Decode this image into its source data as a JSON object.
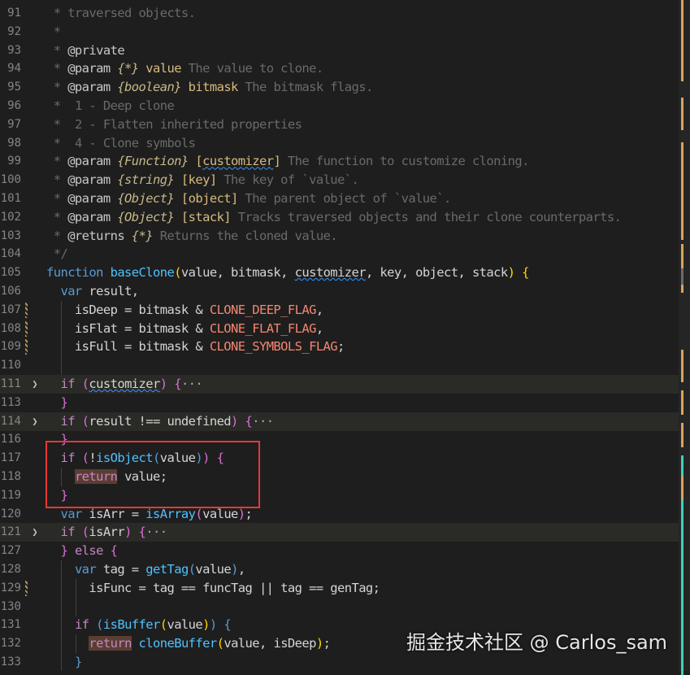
{
  "editor": {
    "lines": [
      {
        "n": "91",
        "fold": false,
        "mod": false,
        "hl": false,
        "t": [
          {
            "c": "cs",
            "s": " * "
          },
          {
            "c": "c",
            "s": "traversed objects."
          }
        ]
      },
      {
        "n": "92",
        "fold": false,
        "mod": false,
        "hl": false,
        "t": [
          {
            "c": "cs",
            "s": " *"
          }
        ]
      },
      {
        "n": "93",
        "fold": false,
        "mod": false,
        "hl": false,
        "t": [
          {
            "c": "cs",
            "s": " * "
          },
          {
            "c": "cl",
            "s": "@private"
          }
        ]
      },
      {
        "n": "94",
        "fold": false,
        "mod": false,
        "hl": false,
        "t": [
          {
            "c": "cs",
            "s": " * "
          },
          {
            "c": "cl",
            "s": "@param "
          },
          {
            "c": "ct",
            "s": "{*}"
          },
          {
            "c": "cp",
            "s": " value"
          },
          {
            "c": "c",
            "s": " The value to clone."
          }
        ]
      },
      {
        "n": "95",
        "fold": false,
        "mod": false,
        "hl": false,
        "t": [
          {
            "c": "cs",
            "s": " * "
          },
          {
            "c": "cl",
            "s": "@param "
          },
          {
            "c": "ct",
            "s": "{boolean}"
          },
          {
            "c": "cp",
            "s": " bitmask"
          },
          {
            "c": "c",
            "s": " The bitmask flags."
          }
        ]
      },
      {
        "n": "96",
        "fold": false,
        "mod": false,
        "hl": false,
        "t": [
          {
            "c": "cs",
            "s": " *  "
          },
          {
            "c": "c",
            "s": "1 - Deep clone"
          }
        ]
      },
      {
        "n": "97",
        "fold": false,
        "mod": false,
        "hl": false,
        "t": [
          {
            "c": "cs",
            "s": " *  "
          },
          {
            "c": "c",
            "s": "2 - Flatten inherited properties"
          }
        ]
      },
      {
        "n": "98",
        "fold": false,
        "mod": false,
        "hl": false,
        "t": [
          {
            "c": "cs",
            "s": " *  "
          },
          {
            "c": "c",
            "s": "4 - Clone symbols"
          }
        ]
      },
      {
        "n": "99",
        "fold": false,
        "mod": false,
        "hl": false,
        "t": [
          {
            "c": "cs",
            "s": " * "
          },
          {
            "c": "cl",
            "s": "@param "
          },
          {
            "c": "ct",
            "s": "{Function}"
          },
          {
            "c": "cp",
            "s": " ["
          },
          {
            "c": "cp sq",
            "s": "customizer"
          },
          {
            "c": "cp",
            "s": "]"
          },
          {
            "c": "c",
            "s": " The function to customize cloning."
          }
        ]
      },
      {
        "n": "100",
        "fold": false,
        "mod": false,
        "hl": false,
        "t": [
          {
            "c": "cs",
            "s": " * "
          },
          {
            "c": "cl",
            "s": "@param "
          },
          {
            "c": "ct",
            "s": "{string}"
          },
          {
            "c": "cp",
            "s": " [key]"
          },
          {
            "c": "c",
            "s": " The key of `value`."
          }
        ]
      },
      {
        "n": "101",
        "fold": false,
        "mod": false,
        "hl": false,
        "t": [
          {
            "c": "cs",
            "s": " * "
          },
          {
            "c": "cl",
            "s": "@param "
          },
          {
            "c": "ct",
            "s": "{Object}"
          },
          {
            "c": "cp",
            "s": " [object]"
          },
          {
            "c": "c",
            "s": " The parent object of `value`."
          }
        ]
      },
      {
        "n": "102",
        "fold": false,
        "mod": false,
        "hl": false,
        "t": [
          {
            "c": "cs",
            "s": " * "
          },
          {
            "c": "cl",
            "s": "@param "
          },
          {
            "c": "ct",
            "s": "{Object}"
          },
          {
            "c": "cp",
            "s": " [stack]"
          },
          {
            "c": "c",
            "s": " Tracks traversed objects and their clone counterparts."
          }
        ]
      },
      {
        "n": "103",
        "fold": false,
        "mod": false,
        "hl": false,
        "t": [
          {
            "c": "cs",
            "s": " * "
          },
          {
            "c": "cl",
            "s": "@returns "
          },
          {
            "c": "ct",
            "s": "{*}"
          },
          {
            "c": "c",
            "s": " Returns the cloned value."
          }
        ]
      },
      {
        "n": "104",
        "fold": false,
        "mod": false,
        "hl": false,
        "t": [
          {
            "c": "cs",
            "s": " */"
          }
        ]
      },
      {
        "n": "105",
        "fold": false,
        "mod": false,
        "hl": false,
        "t": [
          {
            "c": "kb",
            "s": "function "
          },
          {
            "c": "f",
            "s": "baseClone"
          },
          {
            "c": "y",
            "s": "("
          },
          {
            "c": "v",
            "s": "value, bitmask, "
          },
          {
            "c": "v sq",
            "s": "customizer"
          },
          {
            "c": "v",
            "s": ", key, object, stack"
          },
          {
            "c": "y",
            "s": ")"
          },
          {
            "c": "v",
            "s": " "
          },
          {
            "c": "y",
            "s": "{"
          }
        ]
      },
      {
        "n": "106",
        "fold": false,
        "mod": false,
        "hl": false,
        "t": [
          {
            "c": "v",
            "s": "  "
          },
          {
            "c": "kb",
            "s": "var "
          },
          {
            "c": "v",
            "s": "result,"
          }
        ]
      },
      {
        "n": "107",
        "fold": false,
        "mod": true,
        "hl": false,
        "t": [
          {
            "c": "v",
            "s": "    isDeep = bitmask & "
          },
          {
            "c": "cn",
            "s": "CLONE_DEEP_FLAG"
          },
          {
            "c": "v",
            "s": ","
          }
        ]
      },
      {
        "n": "108",
        "fold": false,
        "mod": true,
        "hl": false,
        "t": [
          {
            "c": "v",
            "s": "    isFlat = bitmask & "
          },
          {
            "c": "cn",
            "s": "CLONE_FLAT_FLAG"
          },
          {
            "c": "v",
            "s": ","
          }
        ]
      },
      {
        "n": "109",
        "fold": false,
        "mod": true,
        "hl": false,
        "t": [
          {
            "c": "v",
            "s": "    isFull = bitmask & "
          },
          {
            "c": "cn",
            "s": "CLONE_SYMBOLS_FLAG"
          },
          {
            "c": "v",
            "s": ";"
          }
        ]
      },
      {
        "n": "110",
        "fold": false,
        "mod": false,
        "hl": false,
        "t": []
      },
      {
        "n": "111",
        "fold": true,
        "mod": false,
        "hl": true,
        "t": [
          {
            "c": "v",
            "s": "  "
          },
          {
            "c": "k",
            "s": "if"
          },
          {
            "c": "v",
            "s": " "
          },
          {
            "c": "pu",
            "s": "("
          },
          {
            "c": "v sq",
            "s": "customizer"
          },
          {
            "c": "pu",
            "s": ")"
          },
          {
            "c": "v",
            "s": " "
          },
          {
            "c": "pu",
            "s": "{"
          },
          {
            "c": "e",
            "s": "···"
          }
        ]
      },
      {
        "n": "113",
        "fold": false,
        "mod": false,
        "hl": false,
        "t": [
          {
            "c": "v",
            "s": "  "
          },
          {
            "c": "pu",
            "s": "}"
          }
        ]
      },
      {
        "n": "114",
        "fold": true,
        "mod": false,
        "hl": true,
        "t": [
          {
            "c": "v",
            "s": "  "
          },
          {
            "c": "k",
            "s": "if"
          },
          {
            "c": "v",
            "s": " "
          },
          {
            "c": "pu",
            "s": "("
          },
          {
            "c": "v",
            "s": "result !== undefined"
          },
          {
            "c": "pu",
            "s": ")"
          },
          {
            "c": "v",
            "s": " "
          },
          {
            "c": "pu",
            "s": "{"
          },
          {
            "c": "e",
            "s": "···"
          }
        ]
      },
      {
        "n": "116",
        "fold": false,
        "mod": false,
        "hl": false,
        "t": [
          {
            "c": "v",
            "s": "  "
          },
          {
            "c": "pu",
            "s": "}"
          }
        ]
      },
      {
        "n": "117",
        "fold": false,
        "mod": false,
        "hl": false,
        "t": [
          {
            "c": "v",
            "s": "  "
          },
          {
            "c": "k",
            "s": "if"
          },
          {
            "c": "v",
            "s": " "
          },
          {
            "c": "pu",
            "s": "("
          },
          {
            "c": "v",
            "s": "!"
          },
          {
            "c": "f",
            "s": "isObject"
          },
          {
            "c": "kb",
            "s": "("
          },
          {
            "c": "v",
            "s": "value"
          },
          {
            "c": "kb",
            "s": ")"
          },
          {
            "c": "pu",
            "s": ")"
          },
          {
            "c": "v",
            "s": " "
          },
          {
            "c": "pu",
            "s": "{"
          }
        ]
      },
      {
        "n": "118",
        "fold": false,
        "mod": false,
        "hl": false,
        "t": [
          {
            "c": "v",
            "s": "    "
          },
          {
            "c": "k rh",
            "s": "return"
          },
          {
            "c": "v",
            "s": " value;"
          }
        ]
      },
      {
        "n": "119",
        "fold": false,
        "mod": false,
        "hl": false,
        "t": [
          {
            "c": "v",
            "s": "  "
          },
          {
            "c": "pu",
            "s": "}"
          }
        ]
      },
      {
        "n": "120",
        "fold": false,
        "mod": false,
        "hl": false,
        "t": [
          {
            "c": "v",
            "s": "  "
          },
          {
            "c": "kb",
            "s": "var "
          },
          {
            "c": "v",
            "s": "isArr = "
          },
          {
            "c": "f",
            "s": "isArray"
          },
          {
            "c": "pu",
            "s": "("
          },
          {
            "c": "v",
            "s": "value"
          },
          {
            "c": "pu",
            "s": ")"
          },
          {
            "c": "v",
            "s": ";"
          }
        ]
      },
      {
        "n": "121",
        "fold": true,
        "mod": false,
        "hl": true,
        "t": [
          {
            "c": "v",
            "s": "  "
          },
          {
            "c": "k",
            "s": "if"
          },
          {
            "c": "v",
            "s": " "
          },
          {
            "c": "pu",
            "s": "("
          },
          {
            "c": "v",
            "s": "isArr"
          },
          {
            "c": "pu",
            "s": ")"
          },
          {
            "c": "v",
            "s": " "
          },
          {
            "c": "pu",
            "s": "{"
          },
          {
            "c": "e",
            "s": "···"
          }
        ]
      },
      {
        "n": "127",
        "fold": false,
        "mod": false,
        "hl": false,
        "t": [
          {
            "c": "v",
            "s": "  "
          },
          {
            "c": "pu",
            "s": "}"
          },
          {
            "c": "v",
            "s": " "
          },
          {
            "c": "k",
            "s": "else"
          },
          {
            "c": "v",
            "s": " "
          },
          {
            "c": "pu",
            "s": "{"
          }
        ]
      },
      {
        "n": "128",
        "fold": false,
        "mod": false,
        "hl": false,
        "t": [
          {
            "c": "v",
            "s": "    "
          },
          {
            "c": "kb",
            "s": "var "
          },
          {
            "c": "v",
            "s": "tag = "
          },
          {
            "c": "f",
            "s": "getTag"
          },
          {
            "c": "kb",
            "s": "("
          },
          {
            "c": "v",
            "s": "value"
          },
          {
            "c": "kb",
            "s": ")"
          },
          {
            "c": "v",
            "s": ","
          }
        ]
      },
      {
        "n": "129",
        "fold": false,
        "mod": true,
        "hl": false,
        "t": [
          {
            "c": "v",
            "s": "      isFunc = tag == funcTag || tag == genTag;"
          }
        ]
      },
      {
        "n": "130",
        "fold": false,
        "mod": false,
        "hl": false,
        "t": []
      },
      {
        "n": "131",
        "fold": false,
        "mod": false,
        "hl": false,
        "t": [
          {
            "c": "v",
            "s": "    "
          },
          {
            "c": "k",
            "s": "if"
          },
          {
            "c": "v",
            "s": " "
          },
          {
            "c": "kb",
            "s": "("
          },
          {
            "c": "f",
            "s": "isBuffer"
          },
          {
            "c": "y",
            "s": "("
          },
          {
            "c": "v",
            "s": "value"
          },
          {
            "c": "y",
            "s": ")"
          },
          {
            "c": "kb",
            "s": ")"
          },
          {
            "c": "v",
            "s": " "
          },
          {
            "c": "kb",
            "s": "{"
          }
        ]
      },
      {
        "n": "132",
        "fold": false,
        "mod": false,
        "hl": false,
        "t": [
          {
            "c": "v",
            "s": "      "
          },
          {
            "c": "k rh",
            "s": "return"
          },
          {
            "c": "v",
            "s": " "
          },
          {
            "c": "f",
            "s": "cloneBuffer"
          },
          {
            "c": "y",
            "s": "("
          },
          {
            "c": "v",
            "s": "value, isDeep"
          },
          {
            "c": "y",
            "s": ")"
          },
          {
            "c": "v",
            "s": ";"
          }
        ]
      },
      {
        "n": "133",
        "fold": false,
        "mod": false,
        "hl": false,
        "t": [
          {
            "c": "v",
            "s": "    "
          },
          {
            "c": "kb",
            "s": "}"
          }
        ]
      }
    ]
  },
  "watermark": "掘金技术社区 @ Carlos_sam"
}
